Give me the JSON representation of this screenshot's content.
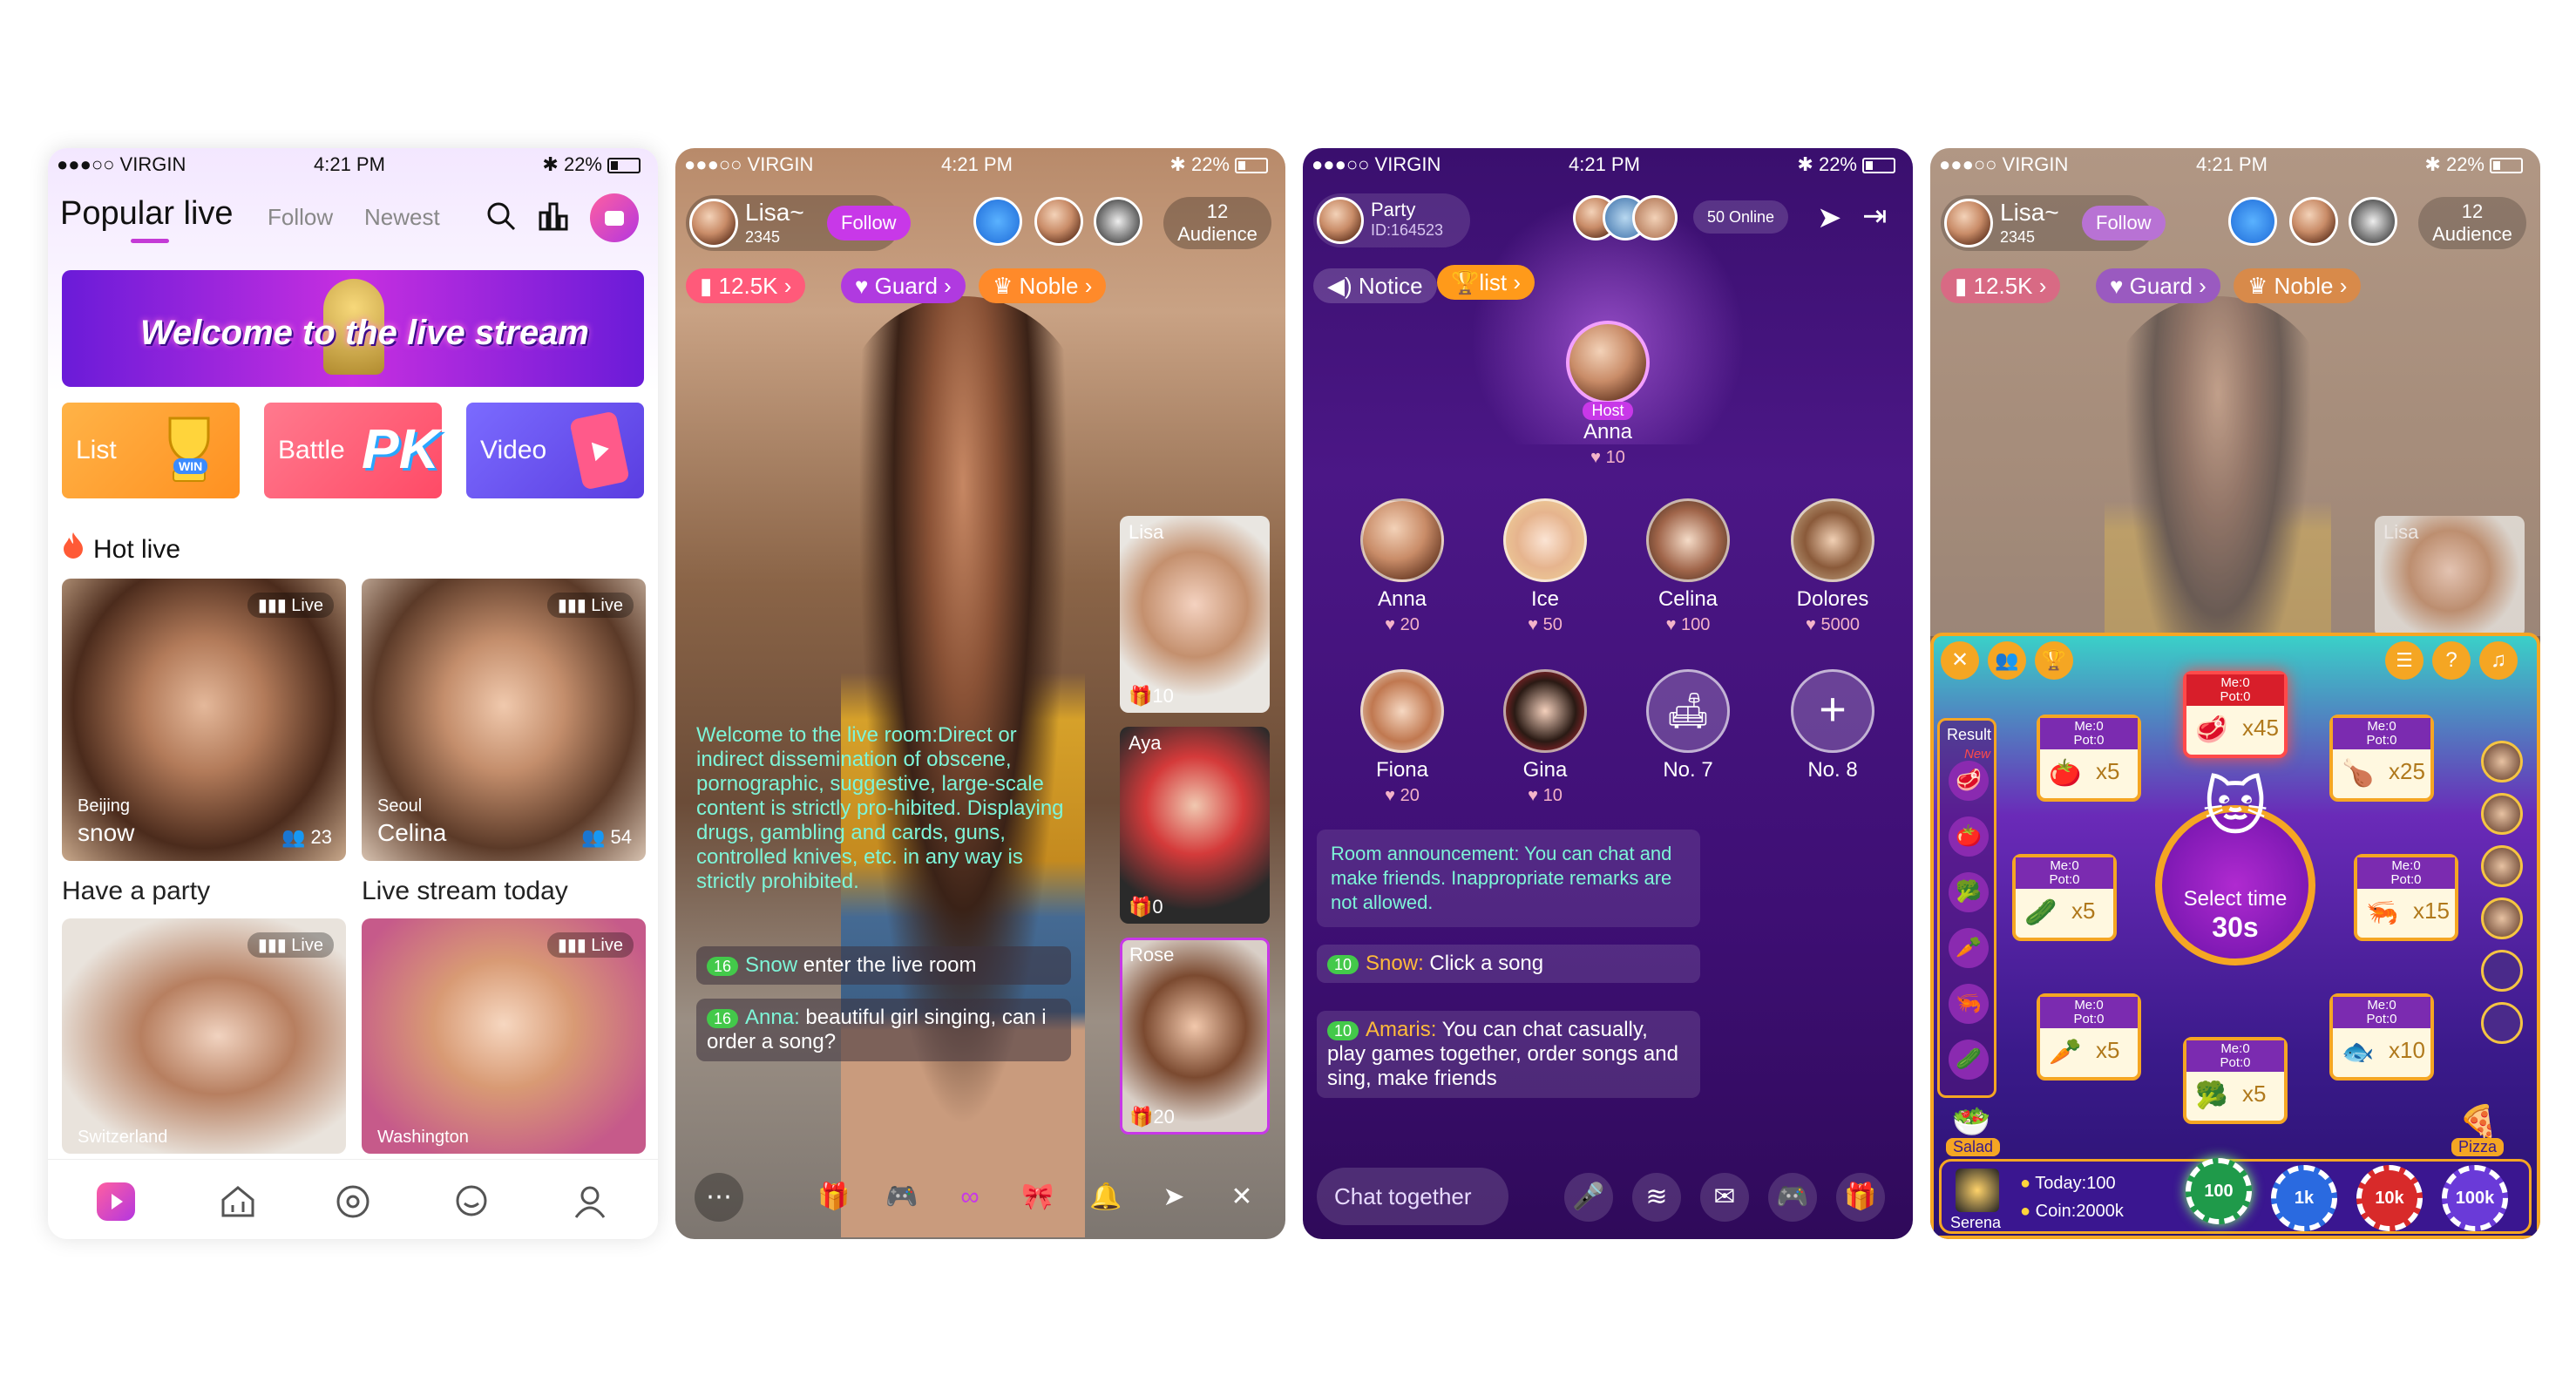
{
  "status_bar": {
    "carrier": "●●●○○ VIRGIN",
    "time": "4:21 PM",
    "battery": "22%"
  },
  "screen1": {
    "tabs": {
      "active": "Popular live",
      "follow": "Follow",
      "newest": "Newest"
    },
    "banner": "Welcome to the live stream",
    "cards": {
      "list": "List",
      "list_badge": "WIN",
      "battle": "Battle",
      "battle_badge": "PK",
      "video": "Video"
    },
    "section_title": "Hot live",
    "live_badge": "Live",
    "streams": [
      {
        "city": "Beijing",
        "name": "snow",
        "viewers": "23",
        "caption": "Have a party"
      },
      {
        "city": "Seoul",
        "name": "Celina",
        "viewers": "54",
        "caption": "Live stream today"
      },
      {
        "city": "Switzerland",
        "name": "",
        "viewers": "",
        "caption": ""
      },
      {
        "city": "Washington",
        "name": "",
        "viewers": "",
        "caption": ""
      }
    ]
  },
  "screen2": {
    "host_name": "Lisa~",
    "host_id": "2345",
    "follow": "Follow",
    "audience_count": "12",
    "audience_label": "Audience",
    "pills": {
      "hearts": "12.5K",
      "guard": "Guard",
      "noble": "Noble"
    },
    "notice": "Welcome to the live room:Direct or indirect dissemination of obscene, pornographic, suggestive, large-scale content is strictly pro-hibited. Displaying drugs, gambling and cards, guns, controlled knives, etc. in any way is strictly prohibited.",
    "chat": [
      {
        "level": "16",
        "user": "Snow",
        "text": "enter the live room"
      },
      {
        "level": "16",
        "user": "Anna:",
        "text": "beautiful girl singing, can i order a song?"
      }
    ],
    "side_streams": [
      {
        "name": "Lisa",
        "count": "10"
      },
      {
        "name": "Aya",
        "count": "0"
      },
      {
        "name": "Rose",
        "count": "20"
      }
    ]
  },
  "screen3": {
    "room_name": "Party",
    "room_id": "ID:164523",
    "online": "50 Online",
    "notice_btn": "Notice",
    "list_btn": "list",
    "host": {
      "tag": "Host",
      "name": "Anna",
      "hearts": "10"
    },
    "seats": [
      {
        "name": "Anna",
        "hearts": "20"
      },
      {
        "name": "Ice",
        "hearts": "50"
      },
      {
        "name": "Celina",
        "hearts": "100"
      },
      {
        "name": "Dolores",
        "hearts": "5000"
      },
      {
        "name": "Fiona",
        "hearts": "20"
      },
      {
        "name": "Gina",
        "hearts": "10"
      },
      {
        "name": "No. 7",
        "hearts": ""
      },
      {
        "name": "No. 8",
        "hearts": ""
      }
    ],
    "announcement": "Room announcement: You can chat and make friends. Inappropriate remarks are not allowed.",
    "chat": [
      {
        "level": "10",
        "user": "Snow:",
        "text": "Click a song"
      },
      {
        "level": "10",
        "user": "Amaris:",
        "text": "You can chat casually, play games together, order songs and sing, make friends"
      }
    ],
    "input_placeholder": "Chat together"
  },
  "screen4": {
    "host_name": "Lisa~",
    "host_id": "2345",
    "follow": "Follow",
    "audience_count": "12",
    "audience_label": "Audience",
    "pills": {
      "hearts": "12.5K",
      "guard": "Guard",
      "noble": "Noble"
    },
    "side_stream": "Lisa",
    "game": {
      "result_label": "Result",
      "new_tag": "New",
      "center_label": "Select time",
      "center_time": "30s",
      "cells": [
        {
          "me": "Me:0",
          "pot": "Pot:0",
          "mult": "x45",
          "emoji": "🥩"
        },
        {
          "me": "Me:0",
          "pot": "Pot:0",
          "mult": "x5",
          "emoji": "🍅"
        },
        {
          "me": "Me:0",
          "pot": "Pot:0",
          "mult": "x25",
          "emoji": "🍗"
        },
        {
          "me": "Me:0",
          "pot": "Pot:0",
          "mult": "x5",
          "emoji": "🥒"
        },
        {
          "me": "Me:0",
          "pot": "Pot:0",
          "mult": "x15",
          "emoji": "🦐"
        },
        {
          "me": "Me:0",
          "pot": "Pot:0",
          "mult": "x5",
          "emoji": "🥕"
        },
        {
          "me": "Me:0",
          "pot": "Pot:0",
          "mult": "x10",
          "emoji": "🐟"
        },
        {
          "me": "Me:0",
          "pot": "Pot:0",
          "mult": "x5",
          "emoji": "🥦"
        }
      ],
      "salad": "Salad",
      "pizza": "Pizza",
      "player": "Serena",
      "today": "Today:100",
      "coin": "Coin:2000k",
      "chips": [
        "100",
        "1k",
        "10k",
        "100k"
      ]
    }
  }
}
